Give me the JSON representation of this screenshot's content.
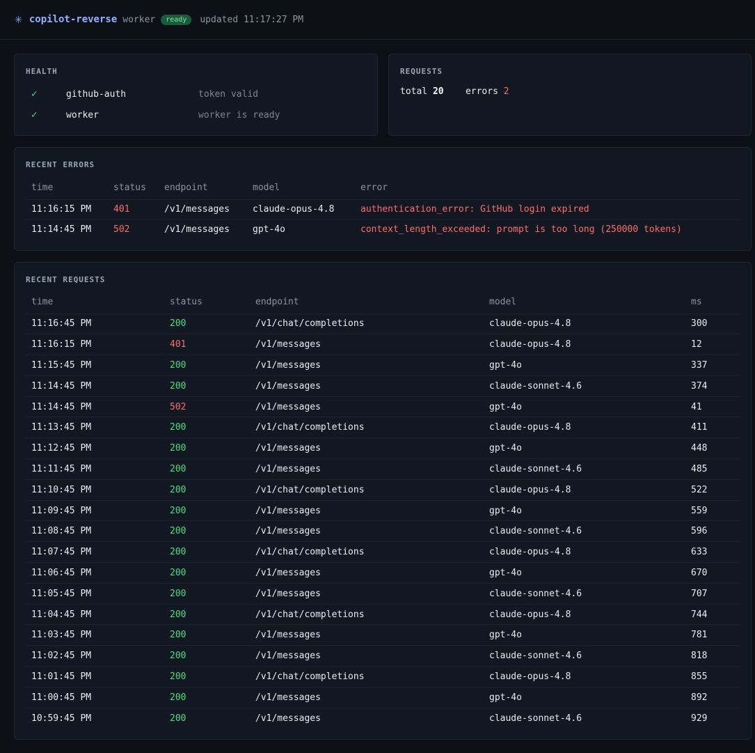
{
  "header": {
    "title": "copilot-reverse",
    "worker_label": "worker",
    "status_badge": "ready",
    "updated": "updated 11:17:27 PM"
  },
  "health": {
    "title": "HEALTH",
    "items": [
      {
        "name": "github-auth",
        "desc": "token valid"
      },
      {
        "name": "worker",
        "desc": "worker is ready"
      }
    ]
  },
  "requests": {
    "title": "REQUESTS",
    "total_label": "total",
    "total": "20",
    "errors_label": "errors",
    "errors": "2"
  },
  "recent_errors": {
    "title": "RECENT ERRORS",
    "columns": [
      "time",
      "status",
      "endpoint",
      "model",
      "error"
    ],
    "rows": [
      {
        "time": "11:16:15 PM",
        "status": "401",
        "endpoint": "/v1/messages",
        "model": "claude-opus-4.8",
        "error": "authentication_error: GitHub login expired"
      },
      {
        "time": "11:14:45 PM",
        "status": "502",
        "endpoint": "/v1/messages",
        "model": "gpt-4o",
        "error": "context_length_exceeded: prompt is too long (250000 tokens)"
      }
    ]
  },
  "recent_requests": {
    "title": "RECENT REQUESTS",
    "columns": [
      "time",
      "status",
      "endpoint",
      "model",
      "ms"
    ],
    "rows": [
      {
        "time": "11:16:45 PM",
        "status": "200",
        "endpoint": "/v1/chat/completions",
        "model": "claude-opus-4.8",
        "ms": "300"
      },
      {
        "time": "11:16:15 PM",
        "status": "401",
        "endpoint": "/v1/messages",
        "model": "claude-opus-4.8",
        "ms": "12"
      },
      {
        "time": "11:15:45 PM",
        "status": "200",
        "endpoint": "/v1/messages",
        "model": "gpt-4o",
        "ms": "337"
      },
      {
        "time": "11:14:45 PM",
        "status": "200",
        "endpoint": "/v1/messages",
        "model": "claude-sonnet-4.6",
        "ms": "374"
      },
      {
        "time": "11:14:45 PM",
        "status": "502",
        "endpoint": "/v1/messages",
        "model": "gpt-4o",
        "ms": "41"
      },
      {
        "time": "11:13:45 PM",
        "status": "200",
        "endpoint": "/v1/chat/completions",
        "model": "claude-opus-4.8",
        "ms": "411"
      },
      {
        "time": "11:12:45 PM",
        "status": "200",
        "endpoint": "/v1/messages",
        "model": "gpt-4o",
        "ms": "448"
      },
      {
        "time": "11:11:45 PM",
        "status": "200",
        "endpoint": "/v1/messages",
        "model": "claude-sonnet-4.6",
        "ms": "485"
      },
      {
        "time": "11:10:45 PM",
        "status": "200",
        "endpoint": "/v1/chat/completions",
        "model": "claude-opus-4.8",
        "ms": "522"
      },
      {
        "time": "11:09:45 PM",
        "status": "200",
        "endpoint": "/v1/messages",
        "model": "gpt-4o",
        "ms": "559"
      },
      {
        "time": "11:08:45 PM",
        "status": "200",
        "endpoint": "/v1/messages",
        "model": "claude-sonnet-4.6",
        "ms": "596"
      },
      {
        "time": "11:07:45 PM",
        "status": "200",
        "endpoint": "/v1/chat/completions",
        "model": "claude-opus-4.8",
        "ms": "633"
      },
      {
        "time": "11:06:45 PM",
        "status": "200",
        "endpoint": "/v1/messages",
        "model": "gpt-4o",
        "ms": "670"
      },
      {
        "time": "11:05:45 PM",
        "status": "200",
        "endpoint": "/v1/messages",
        "model": "claude-sonnet-4.6",
        "ms": "707"
      },
      {
        "time": "11:04:45 PM",
        "status": "200",
        "endpoint": "/v1/chat/completions",
        "model": "claude-opus-4.8",
        "ms": "744"
      },
      {
        "time": "11:03:45 PM",
        "status": "200",
        "endpoint": "/v1/messages",
        "model": "gpt-4o",
        "ms": "781"
      },
      {
        "time": "11:02:45 PM",
        "status": "200",
        "endpoint": "/v1/messages",
        "model": "claude-sonnet-4.6",
        "ms": "818"
      },
      {
        "time": "11:01:45 PM",
        "status": "200",
        "endpoint": "/v1/chat/completions",
        "model": "claude-opus-4.8",
        "ms": "855"
      },
      {
        "time": "11:00:45 PM",
        "status": "200",
        "endpoint": "/v1/messages",
        "model": "gpt-4o",
        "ms": "892"
      },
      {
        "time": "10:59:45 PM",
        "status": "200",
        "endpoint": "/v1/messages",
        "model": "claude-sonnet-4.6",
        "ms": "929"
      }
    ]
  },
  "icons": {
    "logo": "asterisk-icon",
    "check": "check-icon"
  },
  "colors": {
    "ok": "#4ade80",
    "error": "#ff6b6b",
    "accent": "#8fb3ff",
    "badge_bg": "#1a5c3a"
  }
}
